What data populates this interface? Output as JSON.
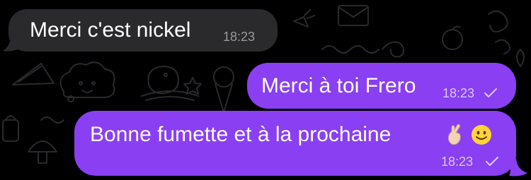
{
  "messages": [
    {
      "direction": "incoming",
      "text": "Merci c'est nickel",
      "time": "18:23"
    },
    {
      "direction": "outgoing",
      "text": "Merci à toi Frero",
      "time": "18:23",
      "status": "sent-check-icon"
    },
    {
      "direction": "outgoing",
      "text": "Bonne fumette et à la prochaine",
      "emojis": [
        "crossed-fingers-icon",
        "smiling-face-icon"
      ],
      "time": "18:23",
      "status": "sent-check-icon"
    }
  ],
  "colors": {
    "background": "#000000",
    "incoming_bubble": "#2a2a2c",
    "outgoing_bubble": "#8a3ff2",
    "incoming_time": "#9a9a9e",
    "outgoing_time": "#dcc8ff",
    "wallpaper_lines": "#2a2a2e"
  }
}
